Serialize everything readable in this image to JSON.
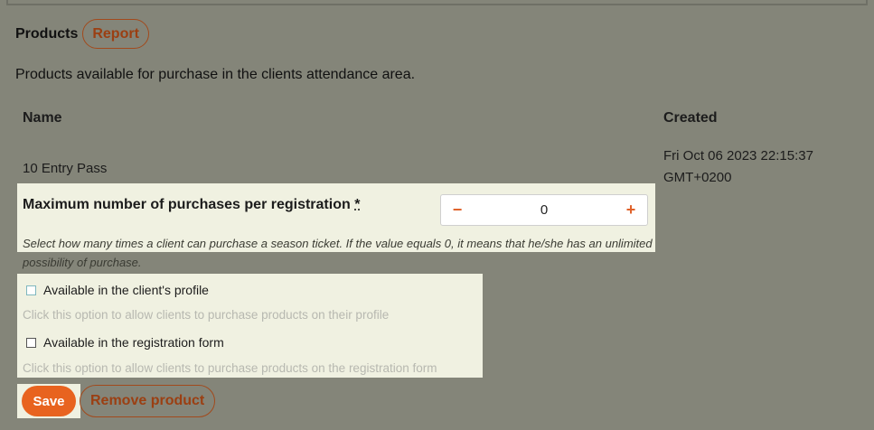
{
  "header": {
    "title": "Products",
    "report_label": "Report"
  },
  "description": "Products available for purchase in the clients attendance area.",
  "table": {
    "columns": [
      "Name",
      "Created"
    ],
    "rows": [
      {
        "name": "10 Entry Pass",
        "created_line1": "Fri Oct 06 2023 22:15:37",
        "created_line2": "GMT+0200"
      }
    ]
  },
  "max_purchases": {
    "label": "Maximum number of purchases per registration",
    "required_mark": "*",
    "value": "0",
    "decrement": "−",
    "increment": "+",
    "hint": "Select how many times a client can purchase a season ticket. If the value equals 0, it means that he/she has an unlimited possibility of purchase."
  },
  "options": [
    {
      "label": "Available in the client's profile",
      "hint": "Click this option to allow clients to purchase products on their profile",
      "checked": false
    },
    {
      "label": "Available in the registration form",
      "hint": "Click this option to allow clients to purchase products on the registration form",
      "checked": false
    }
  ],
  "actions": {
    "save_label": "Save",
    "remove_label": "Remove product"
  },
  "colors": {
    "accent": "#e8631f",
    "link": "#9b3f12",
    "panel": "#f0f1e1",
    "background": "#848579"
  }
}
